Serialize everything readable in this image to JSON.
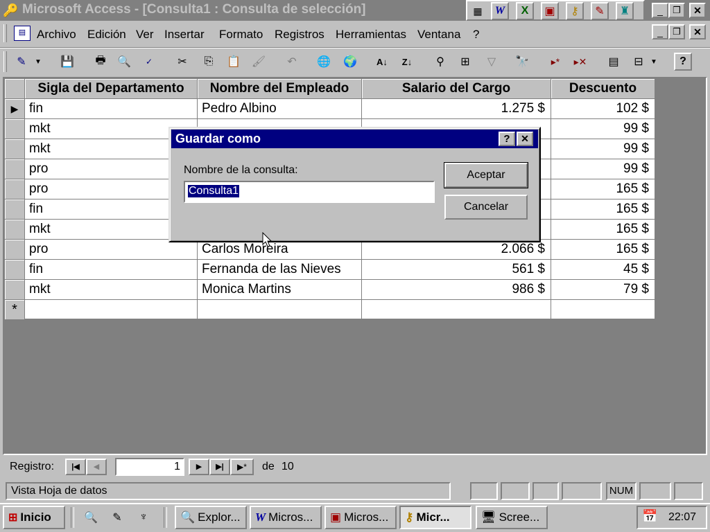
{
  "window": {
    "title": "Microsoft Access - [Consulta1 : Consulta de selección]"
  },
  "menu": [
    "Archivo",
    "Edición",
    "Ver",
    "Insertar",
    "Formato",
    "Registros",
    "Herramientas",
    "Ventana",
    "?"
  ],
  "table": {
    "columns": [
      "Sigla del Departamento",
      "Nombre del Empleado",
      "Salario del Cargo",
      "Descuento"
    ],
    "rows": [
      [
        "fin",
        "Pedro Albino",
        "1.275 $",
        "102 $"
      ],
      [
        "mkt",
        "",
        "",
        "99 $"
      ],
      [
        "mkt",
        "",
        "",
        "99 $"
      ],
      [
        "pro",
        "",
        "",
        "99 $"
      ],
      [
        "pro",
        "",
        "",
        "165 $"
      ],
      [
        "fin",
        "",
        "",
        "165 $"
      ],
      [
        "mkt",
        "",
        "",
        "165 $"
      ],
      [
        "pro",
        "Carlos Moreira",
        "2.066 $",
        "165 $"
      ],
      [
        "fin",
        "Fernanda de las Nieves",
        "561 $",
        "45 $"
      ],
      [
        "mkt",
        "Monica Martins",
        "986 $",
        "79 $"
      ]
    ],
    "new_row_marker": "*"
  },
  "dialog": {
    "title": "Guardar como",
    "label": "Nombre de la consulta:",
    "value": "Consulta1",
    "ok": "Aceptar",
    "cancel": "Cancelar",
    "help": "?",
    "close": "✕"
  },
  "navigation": {
    "label": "Registro:",
    "current": "1",
    "of_label": "de",
    "total": "10"
  },
  "status": {
    "text": "Vista Hoja de datos",
    "num": "NUM"
  },
  "taskbar": {
    "start": "Inicio",
    "tasks": [
      "Explor...",
      "Micros...",
      "Micros...",
      "Micr...",
      "Scree..."
    ],
    "clock": "22:07"
  },
  "colors": {
    "titlebar_inactive": "#808080",
    "titlebar_active": "#000080",
    "selection": "#000080"
  }
}
